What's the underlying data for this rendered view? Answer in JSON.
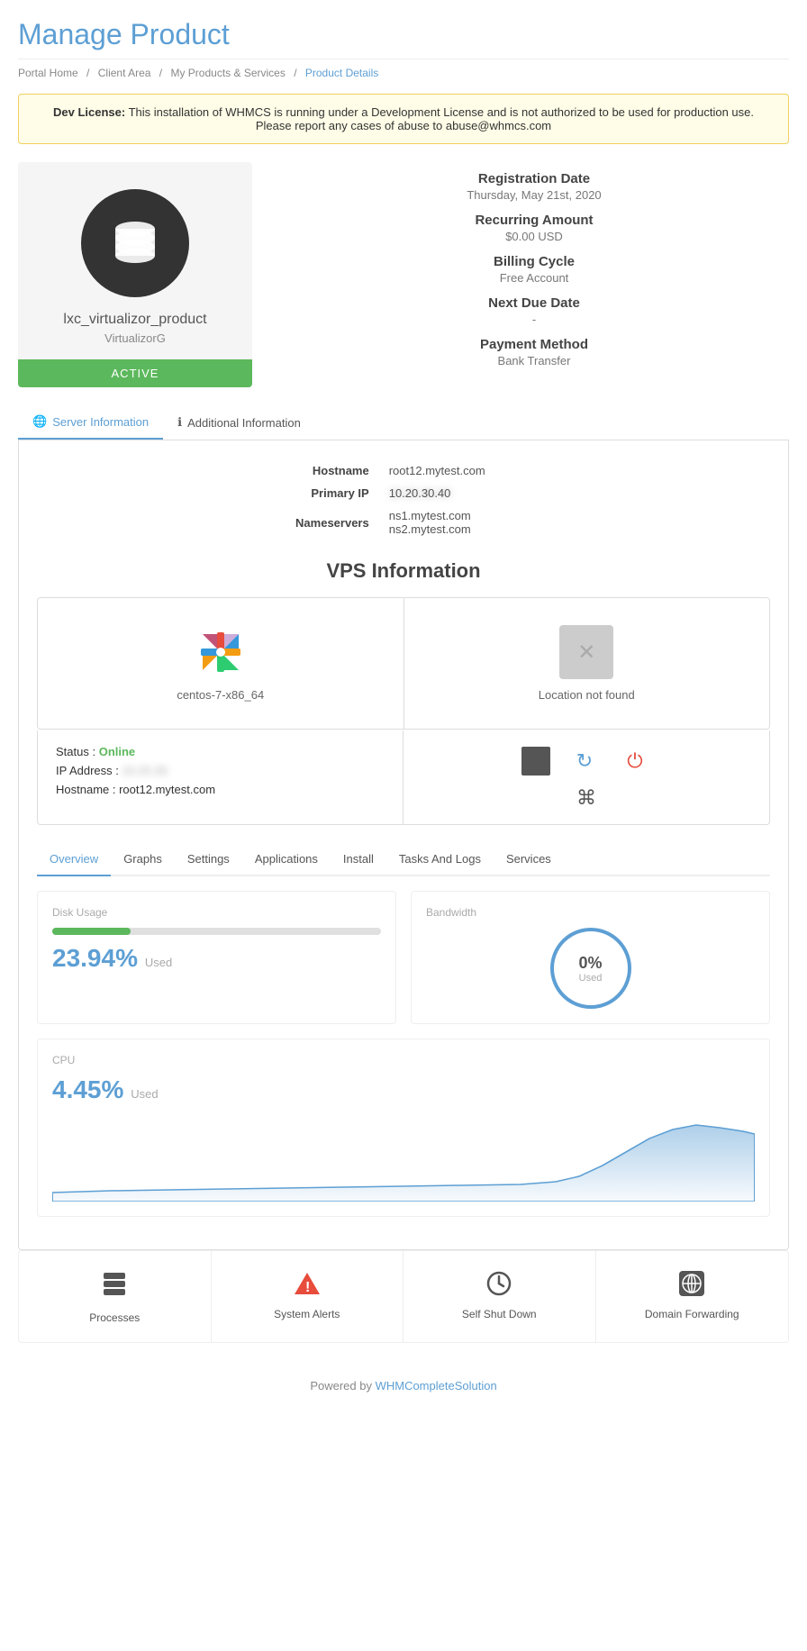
{
  "page": {
    "title": "Manage Product",
    "breadcrumbs": [
      {
        "label": "Portal Home",
        "active": false
      },
      {
        "label": "Client Area",
        "active": false
      },
      {
        "label": "My Products & Services",
        "active": false
      },
      {
        "label": "Product Details",
        "active": true
      }
    ]
  },
  "devNotice": {
    "prefix": "Dev License:",
    "text": " This installation of WHMCS is running under a Development License and is not authorized to be used for production use. Please report any cases of abuse to abuse@whmcs.com"
  },
  "product": {
    "name": "lxc_virtualizor_product",
    "provider": "VirtualizorG",
    "status": "ACTIVE",
    "registrationDateLabel": "Registration Date",
    "registrationDate": "Thursday, May 21st, 2020",
    "recurringAmountLabel": "Recurring Amount",
    "recurringAmount": "$0.00 USD",
    "billingCycleLabel": "Billing Cycle",
    "billingCycle": "Free Account",
    "nextDueDateLabel": "Next Due Date",
    "nextDueDate": "-",
    "paymentMethodLabel": "Payment Method",
    "paymentMethod": "Bank Transfer"
  },
  "tabs": {
    "serverInfo": "Server Information",
    "additionalInfo": "Additional Information"
  },
  "serverInfo": {
    "hostname": "root12.mytest.com",
    "primaryIP": "███████",
    "nameservers": [
      "ns1.mytest.com",
      "ns2.mytest.com"
    ]
  },
  "vpsSection": {
    "title": "VPS Information",
    "os": "centos-7-x86_64",
    "locationNotFound": "Location not found",
    "statusLabel": "Status :",
    "statusValue": "Online",
    "ipLabel": "IP Address :",
    "ipValue": "███████",
    "hostnameLabel": "Hostname :",
    "hostnameValue": "root12.mytest.com"
  },
  "overviewTabs": [
    "Overview",
    "Graphs",
    "Settings",
    "Applications",
    "Install",
    "Tasks And Logs",
    "Services"
  ],
  "diskUsage": {
    "label": "Disk Usage",
    "percent": 23.94,
    "percentText": "23.94%",
    "usedLabel": "Used"
  },
  "bandwidth": {
    "label": "Bandwidth",
    "percent": "0%",
    "usedLabel": "Used"
  },
  "cpu": {
    "label": "CPU",
    "percent": "4.45%",
    "usedLabel": "Used"
  },
  "bottomActions": [
    {
      "label": "Processes",
      "icon": "layers"
    },
    {
      "label": "System Alerts",
      "icon": "warning"
    },
    {
      "label": "Self Shut Down",
      "icon": "clock"
    },
    {
      "label": "Domain Forwarding",
      "icon": "globe"
    }
  ],
  "footer": {
    "text": "Powered by ",
    "linkText": "WHMCompleteSolution"
  }
}
